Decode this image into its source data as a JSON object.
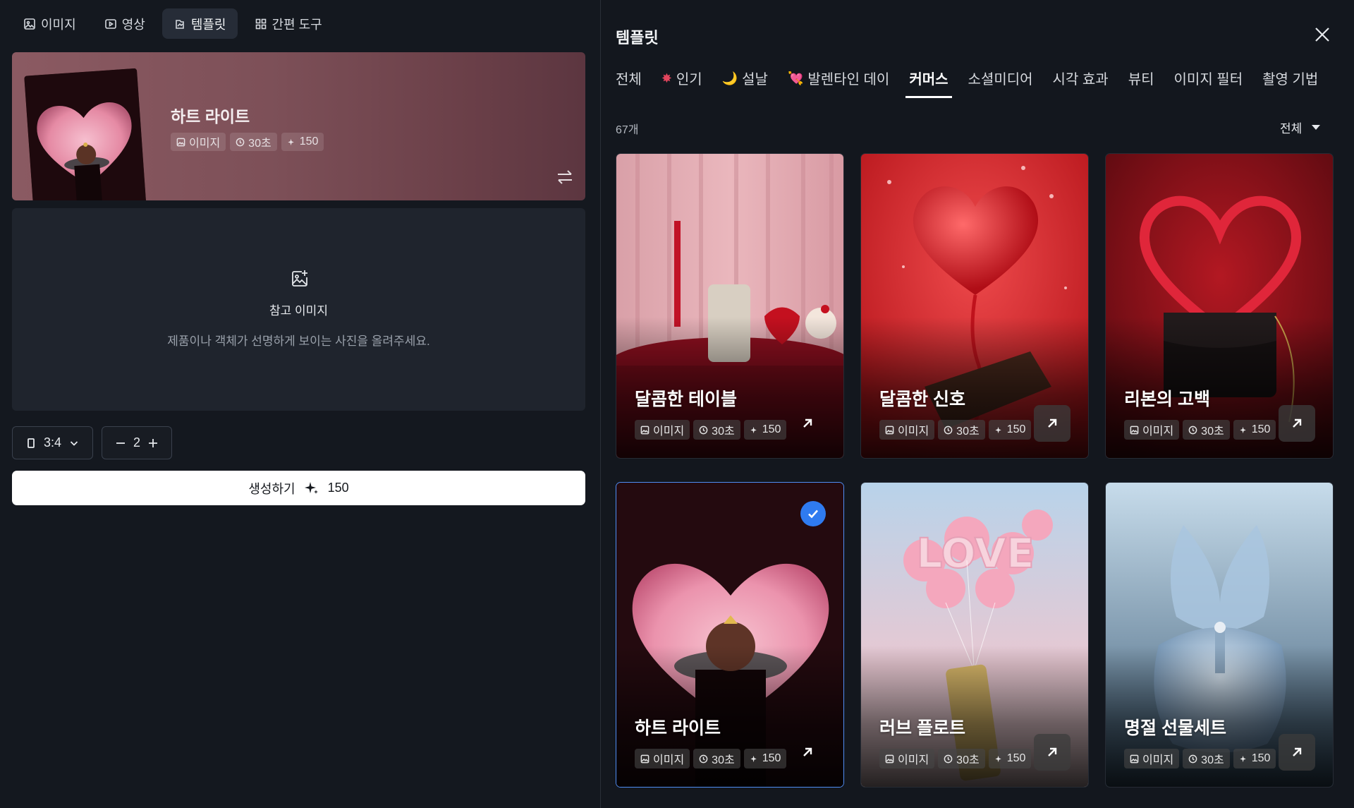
{
  "topnav": {
    "tabs": [
      {
        "label": "이미지",
        "icon": "image-icon"
      },
      {
        "label": "영상",
        "icon": "video-icon"
      },
      {
        "label": "템플릿",
        "icon": "template-icon",
        "active": true
      },
      {
        "label": "간편 도구",
        "icon": "grid-icon"
      }
    ]
  },
  "banner": {
    "title": "하트 라이트",
    "badges": {
      "type": "이미지",
      "duration": "30초",
      "credits": "150"
    }
  },
  "upload": {
    "title": "참고 이미지",
    "subtitle": "제품이나 객체가 선명하게 보이는 사진을 올려주세요."
  },
  "controls": {
    "ratio": "3:4",
    "count": "2"
  },
  "generate": {
    "label": "생성하기",
    "credits": "150"
  },
  "templates": {
    "title": "템플릿",
    "categories": [
      {
        "label": "전체",
        "emoji": ""
      },
      {
        "label": "인기",
        "emoji": "✸"
      },
      {
        "label": "설날",
        "emoji": "🌙"
      },
      {
        "label": "발렌타인 데이",
        "emoji": "💘"
      },
      {
        "label": "커머스",
        "emoji": "",
        "active": true
      },
      {
        "label": "소셜미디어",
        "emoji": ""
      },
      {
        "label": "시각 효과",
        "emoji": ""
      },
      {
        "label": "뷰티",
        "emoji": ""
      },
      {
        "label": "이미지 필터",
        "emoji": ""
      },
      {
        "label": "촬영 기법",
        "emoji": ""
      }
    ],
    "count": "67개",
    "sort": "전체",
    "cards": [
      {
        "title": "달콤한 테이블",
        "type": "이미지",
        "duration": "30초",
        "credits": "150",
        "selected": false
      },
      {
        "title": "달콤한 신호",
        "type": "이미지",
        "duration": "30초",
        "credits": "150",
        "selected": false
      },
      {
        "title": "리본의 고백",
        "type": "이미지",
        "duration": "30초",
        "credits": "150",
        "selected": false
      },
      {
        "title": "하트 라이트",
        "type": "이미지",
        "duration": "30초",
        "credits": "150",
        "selected": true
      },
      {
        "title": "러브 플로트",
        "type": "이미지",
        "duration": "30초",
        "credits": "150",
        "selected": false
      },
      {
        "title": "명절 선물세트",
        "type": "이미지",
        "duration": "30초",
        "credits": "150",
        "selected": false
      }
    ]
  },
  "colors": {
    "selected_border": "#4f8ef5",
    "check_badge": "#2f7bf0",
    "page_bg": "#13171e"
  }
}
